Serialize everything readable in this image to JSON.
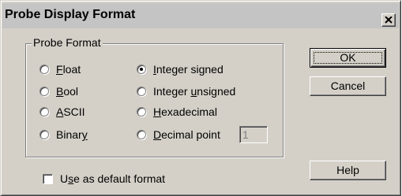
{
  "window": {
    "title": "Probe Display Format",
    "close_icon": "close-icon"
  },
  "probe_format": {
    "group_label": "Probe Format",
    "selected": "Integer signed",
    "options": [
      {
        "pre": "",
        "u": "F",
        "post": "loat",
        "checked": false
      },
      {
        "pre": "",
        "u": "B",
        "post": "ool",
        "checked": false
      },
      {
        "pre": "",
        "u": "A",
        "post": "SCII",
        "checked": false
      },
      {
        "pre": "Binar",
        "u": "y",
        "post": "",
        "checked": false
      },
      {
        "pre": "",
        "u": "I",
        "post": "nteger signed",
        "checked": true
      },
      {
        "pre": "Integer ",
        "u": "u",
        "post": "nsigned",
        "checked": false
      },
      {
        "pre": "",
        "u": "H",
        "post": "exadecimal",
        "checked": false
      },
      {
        "pre": "",
        "u": "D",
        "post": "ecimal point",
        "checked": false
      }
    ],
    "decimal_point_value": "1"
  },
  "default_format": {
    "pre": "U",
    "u": "s",
    "post": "e as default format",
    "checked": false
  },
  "buttons": {
    "ok": "OK",
    "cancel": "Cancel",
    "help": "Help"
  }
}
